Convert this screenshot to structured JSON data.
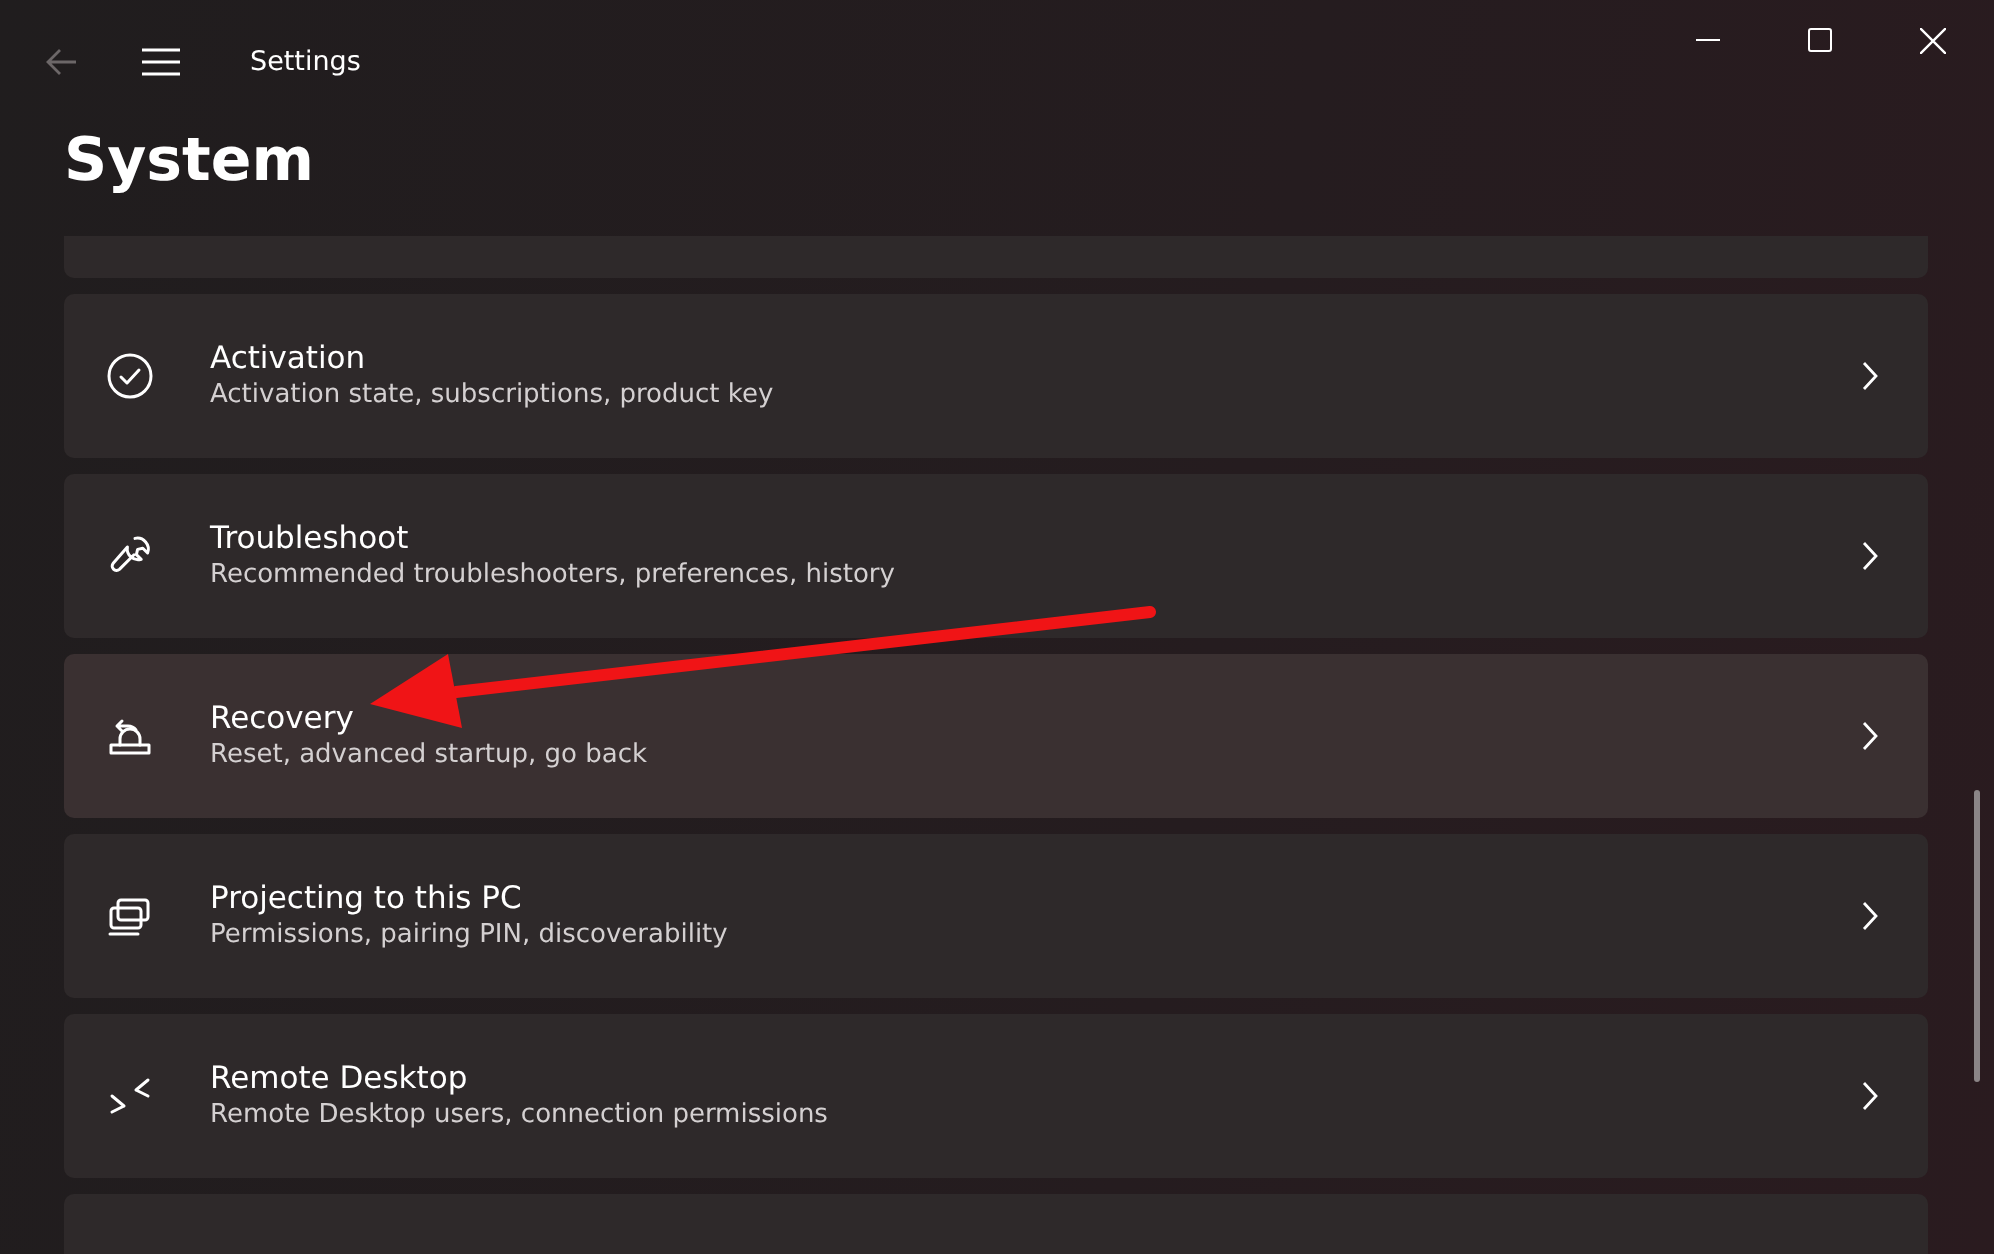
{
  "window": {
    "title": "Settings"
  },
  "page_title": "System",
  "items": [
    {
      "title": "Activation",
      "subtitle": "Activation state, subscriptions, product key",
      "selected": false
    },
    {
      "title": "Troubleshoot",
      "subtitle": "Recommended troubleshooters, preferences, history",
      "selected": false
    },
    {
      "title": "Recovery",
      "subtitle": "Reset, advanced startup, go back",
      "selected": true
    },
    {
      "title": "Projecting to this PC",
      "subtitle": "Permissions, pairing PIN, discoverability",
      "selected": false
    },
    {
      "title": "Remote Desktop",
      "subtitle": "Remote Desktop users, connection permissions",
      "selected": false
    }
  ]
}
